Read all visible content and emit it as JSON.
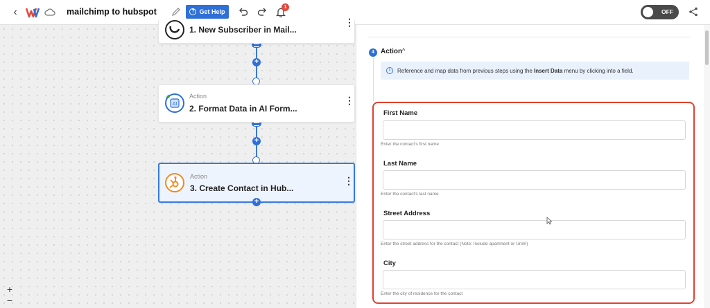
{
  "topbar": {
    "back": "‹",
    "title": "mailchimp to hubspot",
    "help_label": "Get Help",
    "notification_count": "1",
    "toggle_label": "OFF",
    "brand_color": "#2e6fd8"
  },
  "nodes": [
    {
      "kind": "",
      "name": "1. New Subscriber in Mail..."
    },
    {
      "kind": "Action",
      "name": "2. Format Data in AI Form..."
    },
    {
      "kind": "Action",
      "name": "3. Create Contact in Hub..."
    }
  ],
  "zoom": {
    "in": "+",
    "out": "−"
  },
  "panel": {
    "step_number": "4",
    "section_title": "Action",
    "info_text_before": "Reference and map data from previous steps using the ",
    "info_bold": "Insert Data",
    "info_text_after": " menu by clicking into a field.",
    "fields": [
      {
        "label": "First Name",
        "value": "",
        "hint": "Enter the contact's first name"
      },
      {
        "label": "Last Name",
        "value": "",
        "hint": "Enter the contact's last name"
      },
      {
        "label": "Street Address",
        "value": "",
        "hint": "Enter the street address for the contact (Note: Include apartment or Unit#)"
      },
      {
        "label": "City",
        "value": "",
        "hint": "Enter the city of residence for the contact"
      }
    ]
  }
}
